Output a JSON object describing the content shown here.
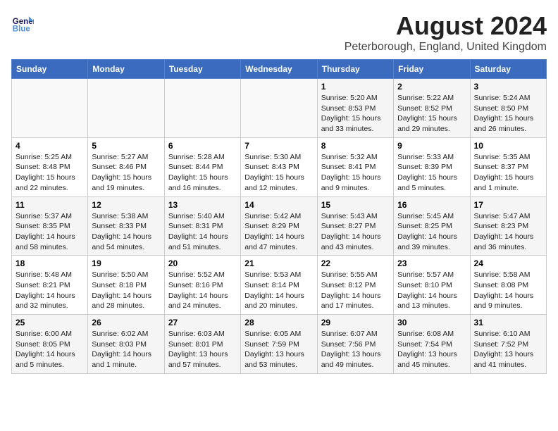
{
  "header": {
    "logo_line1": "General",
    "logo_line2": "Blue",
    "main_title": "August 2024",
    "subtitle": "Peterborough, England, United Kingdom"
  },
  "weekdays": [
    "Sunday",
    "Monday",
    "Tuesday",
    "Wednesday",
    "Thursday",
    "Friday",
    "Saturday"
  ],
  "weeks": [
    [
      {
        "day": "",
        "text": ""
      },
      {
        "day": "",
        "text": ""
      },
      {
        "day": "",
        "text": ""
      },
      {
        "day": "",
        "text": ""
      },
      {
        "day": "1",
        "text": "Sunrise: 5:20 AM\nSunset: 8:53 PM\nDaylight: 15 hours\nand 33 minutes."
      },
      {
        "day": "2",
        "text": "Sunrise: 5:22 AM\nSunset: 8:52 PM\nDaylight: 15 hours\nand 29 minutes."
      },
      {
        "day": "3",
        "text": "Sunrise: 5:24 AM\nSunset: 8:50 PM\nDaylight: 15 hours\nand 26 minutes."
      }
    ],
    [
      {
        "day": "4",
        "text": "Sunrise: 5:25 AM\nSunset: 8:48 PM\nDaylight: 15 hours\nand 22 minutes."
      },
      {
        "day": "5",
        "text": "Sunrise: 5:27 AM\nSunset: 8:46 PM\nDaylight: 15 hours\nand 19 minutes."
      },
      {
        "day": "6",
        "text": "Sunrise: 5:28 AM\nSunset: 8:44 PM\nDaylight: 15 hours\nand 16 minutes."
      },
      {
        "day": "7",
        "text": "Sunrise: 5:30 AM\nSunset: 8:43 PM\nDaylight: 15 hours\nand 12 minutes."
      },
      {
        "day": "8",
        "text": "Sunrise: 5:32 AM\nSunset: 8:41 PM\nDaylight: 15 hours\nand 9 minutes."
      },
      {
        "day": "9",
        "text": "Sunrise: 5:33 AM\nSunset: 8:39 PM\nDaylight: 15 hours\nand 5 minutes."
      },
      {
        "day": "10",
        "text": "Sunrise: 5:35 AM\nSunset: 8:37 PM\nDaylight: 15 hours\nand 1 minute."
      }
    ],
    [
      {
        "day": "11",
        "text": "Sunrise: 5:37 AM\nSunset: 8:35 PM\nDaylight: 14 hours\nand 58 minutes."
      },
      {
        "day": "12",
        "text": "Sunrise: 5:38 AM\nSunset: 8:33 PM\nDaylight: 14 hours\nand 54 minutes."
      },
      {
        "day": "13",
        "text": "Sunrise: 5:40 AM\nSunset: 8:31 PM\nDaylight: 14 hours\nand 51 minutes."
      },
      {
        "day": "14",
        "text": "Sunrise: 5:42 AM\nSunset: 8:29 PM\nDaylight: 14 hours\nand 47 minutes."
      },
      {
        "day": "15",
        "text": "Sunrise: 5:43 AM\nSunset: 8:27 PM\nDaylight: 14 hours\nand 43 minutes."
      },
      {
        "day": "16",
        "text": "Sunrise: 5:45 AM\nSunset: 8:25 PM\nDaylight: 14 hours\nand 39 minutes."
      },
      {
        "day": "17",
        "text": "Sunrise: 5:47 AM\nSunset: 8:23 PM\nDaylight: 14 hours\nand 36 minutes."
      }
    ],
    [
      {
        "day": "18",
        "text": "Sunrise: 5:48 AM\nSunset: 8:21 PM\nDaylight: 14 hours\nand 32 minutes."
      },
      {
        "day": "19",
        "text": "Sunrise: 5:50 AM\nSunset: 8:18 PM\nDaylight: 14 hours\nand 28 minutes."
      },
      {
        "day": "20",
        "text": "Sunrise: 5:52 AM\nSunset: 8:16 PM\nDaylight: 14 hours\nand 24 minutes."
      },
      {
        "day": "21",
        "text": "Sunrise: 5:53 AM\nSunset: 8:14 PM\nDaylight: 14 hours\nand 20 minutes."
      },
      {
        "day": "22",
        "text": "Sunrise: 5:55 AM\nSunset: 8:12 PM\nDaylight: 14 hours\nand 17 minutes."
      },
      {
        "day": "23",
        "text": "Sunrise: 5:57 AM\nSunset: 8:10 PM\nDaylight: 14 hours\nand 13 minutes."
      },
      {
        "day": "24",
        "text": "Sunrise: 5:58 AM\nSunset: 8:08 PM\nDaylight: 14 hours\nand 9 minutes."
      }
    ],
    [
      {
        "day": "25",
        "text": "Sunrise: 6:00 AM\nSunset: 8:05 PM\nDaylight: 14 hours\nand 5 minutes."
      },
      {
        "day": "26",
        "text": "Sunrise: 6:02 AM\nSunset: 8:03 PM\nDaylight: 14 hours\nand 1 minute."
      },
      {
        "day": "27",
        "text": "Sunrise: 6:03 AM\nSunset: 8:01 PM\nDaylight: 13 hours\nand 57 minutes."
      },
      {
        "day": "28",
        "text": "Sunrise: 6:05 AM\nSunset: 7:59 PM\nDaylight: 13 hours\nand 53 minutes."
      },
      {
        "day": "29",
        "text": "Sunrise: 6:07 AM\nSunset: 7:56 PM\nDaylight: 13 hours\nand 49 minutes."
      },
      {
        "day": "30",
        "text": "Sunrise: 6:08 AM\nSunset: 7:54 PM\nDaylight: 13 hours\nand 45 minutes."
      },
      {
        "day": "31",
        "text": "Sunrise: 6:10 AM\nSunset: 7:52 PM\nDaylight: 13 hours\nand 41 minutes."
      }
    ]
  ]
}
